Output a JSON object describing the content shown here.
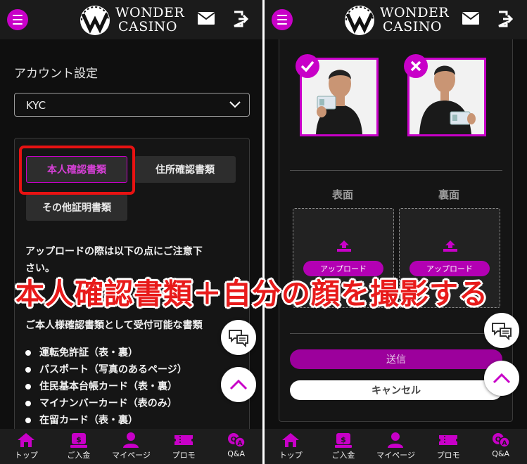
{
  "header": {
    "logo_line1": "WONDER",
    "logo_line2": "CASINO"
  },
  "left": {
    "section_title": "アカウント設定",
    "select_value": "KYC",
    "tabs": [
      {
        "label": "本人確認書類",
        "active": true
      },
      {
        "label": "住所確認書類",
        "active": false
      },
      {
        "label": "その他証明書類",
        "active": false
      }
    ],
    "notice_line1": "アップロードの際は以下の点にご注意下",
    "notice_line2": "さい。",
    "accepted_heading": "ご本人様確認書類として受付可能な書類",
    "documents": [
      "運転免許証（表・裏）",
      "パスポート（写真のあるページ）",
      "住民基本台帳カード（表・裏）",
      "マイナンバーカード（表のみ）",
      "在留カード（表・裏）"
    ]
  },
  "right": {
    "front_label": "表面",
    "back_label": "裏面",
    "upload_label": "アップロード",
    "send_label": "送信",
    "cancel_label": "キャンセル"
  },
  "nav": [
    {
      "label": "トップ",
      "icon": "home-icon"
    },
    {
      "label": "ご入金",
      "icon": "deposit-icon"
    },
    {
      "label": "マイページ",
      "icon": "user-icon"
    },
    {
      "label": "プロモ",
      "icon": "ticket-icon"
    },
    {
      "label": "Q&A",
      "icon": "qa-icon"
    }
  ],
  "caption": "本人確認書類＋自分の顔を撮影する",
  "colors": {
    "accent": "#c800c8",
    "highlight": "#e81212",
    "background": "#0f0f0f"
  }
}
